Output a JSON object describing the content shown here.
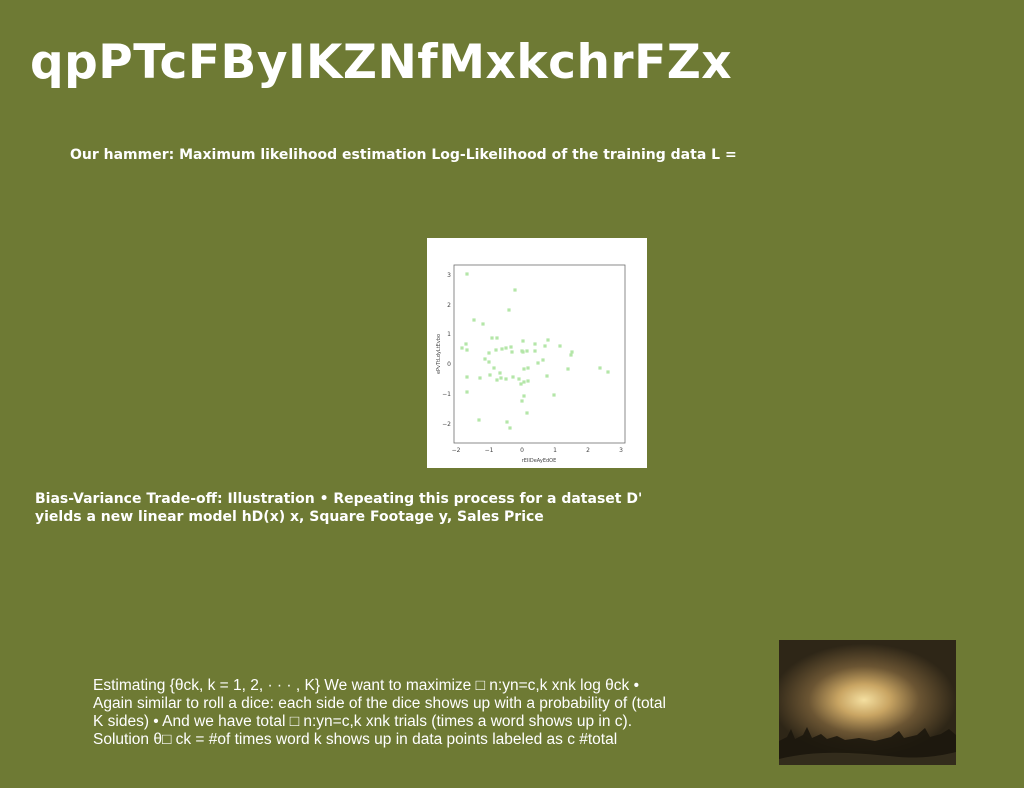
{
  "slide": {
    "title": "qpPTcFByIKZNfMxkchrFZx",
    "subheading": "Our hammer: Maximum likelihood estimation Log-Likelihood of the training data L =",
    "illustration_text": "Bias-Variance Trade-off: Illustration • Repeating this process for a dataset D' yields a new linear model hD(x) x, Square Footage y, Sales Price",
    "body_text": "Estimating {θck, k = 1, 2, · · · , K} We want to maximize □ n:yn=c,k xnk log θck • Again similar to roll a dice: each side of the dice shows up with a probability of (total K sides) • And we have total □ n:yn=c,k xnk trials (times a word shows up in c). Solution θ□ ck = #of times word k shows up in data points labeled as c #total"
  },
  "plot": {
    "xlabel": "rEIIDeAyEdOE",
    "ylabel": "ePvTtLdyLtEvbo",
    "x_ticks": [
      "−2",
      "−1",
      "0",
      "1",
      "2",
      "3"
    ],
    "y_ticks": [
      "3",
      "2",
      "1",
      "0",
      "−1",
      "−2"
    ],
    "point_color": "#b4e6a8"
  },
  "photo": {
    "description": "sepia night landscape with glowing sky"
  }
}
